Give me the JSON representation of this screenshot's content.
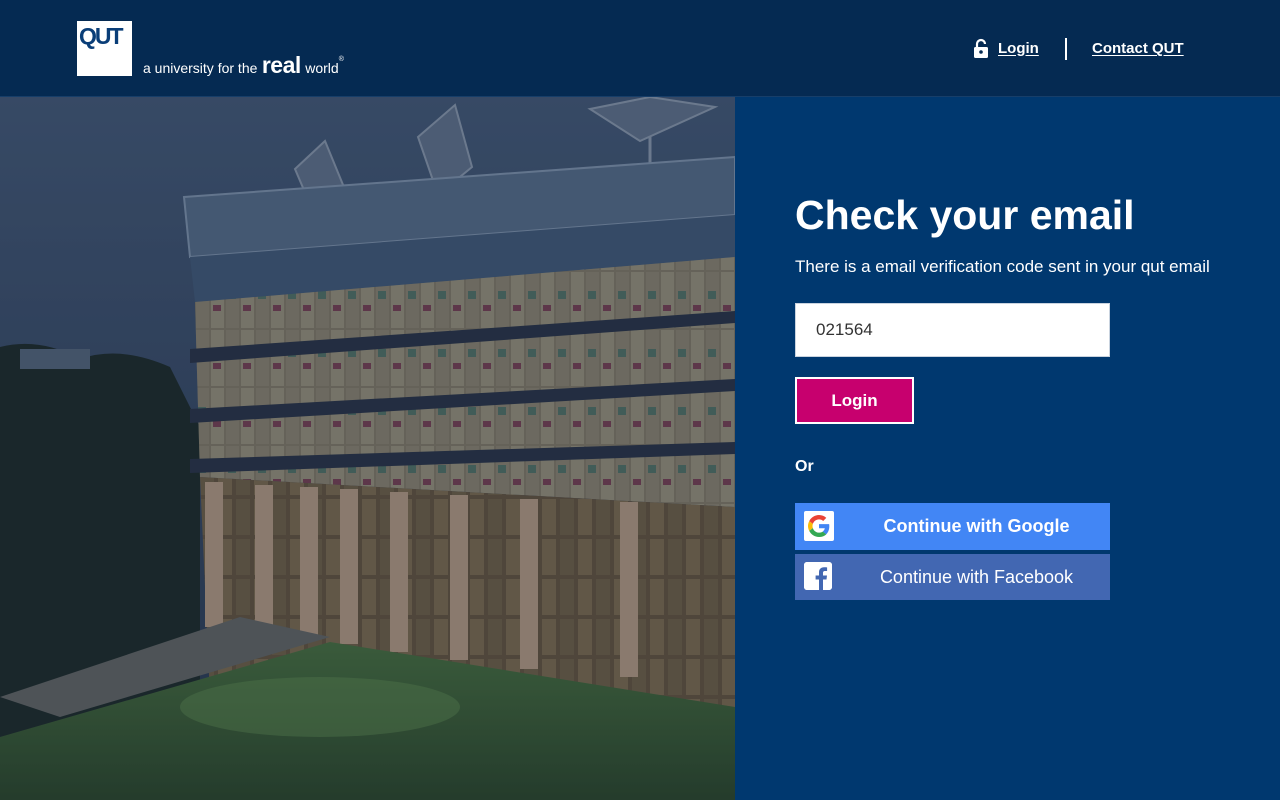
{
  "header": {
    "logo_text": "QUT",
    "tagline_prefix": "a university for the",
    "tagline_emphasis": "real",
    "tagline_suffix": "world",
    "tagline_mark": "®",
    "nav_login_label": "Login",
    "nav_contact_label": "Contact QUT",
    "lock_icon": "lock-icon"
  },
  "main": {
    "title": "Check your email",
    "subtitle": "There is a email verification code sent in your qut email",
    "code_input_value": "021564",
    "login_button_label": "Login",
    "or_label": "Or",
    "google_button_label": "Continue with Google",
    "facebook_button_label": "Continue with Facebook",
    "google_icon": "google-icon",
    "facebook_icon": "facebook-icon"
  },
  "colors": {
    "header_bg": "#052a52",
    "panel_bg": "#00386f",
    "login_button": "#c7006e",
    "google_button": "#4286f5",
    "facebook_button": "#4267b2"
  }
}
